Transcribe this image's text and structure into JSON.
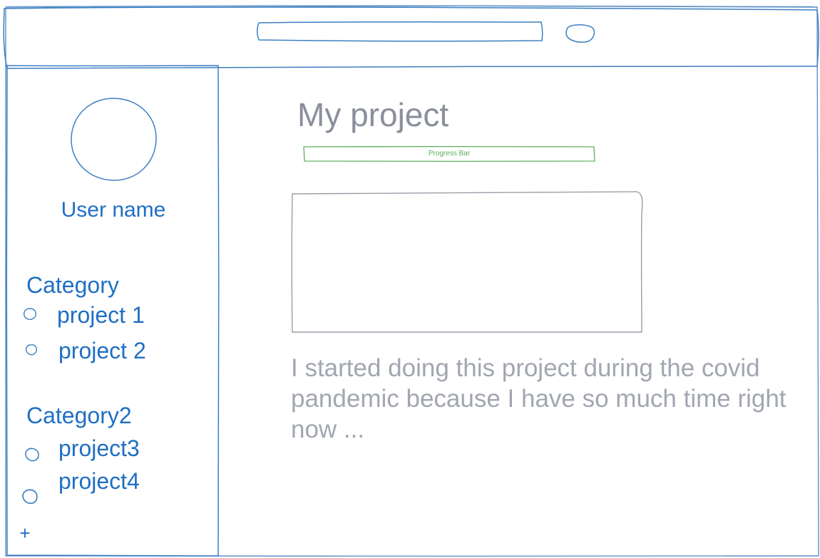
{
  "header": {
    "search": {
      "value": "",
      "placeholder": ""
    }
  },
  "sidebar": {
    "user_name": "User name",
    "categories": [
      {
        "title": "Category",
        "projects": [
          "project 1",
          "project 2"
        ]
      },
      {
        "title": "Category2",
        "projects": [
          "project3",
          "project4"
        ]
      }
    ],
    "add_label": "+"
  },
  "main": {
    "title": "My project",
    "progress": {
      "label": "Progress Bar"
    },
    "description": "I started doing this project during the covid pandemic because I have so much time right now ..."
  },
  "colors": {
    "sketch_line": "#3d7fc1",
    "sidebar_text": "#1f6fc4",
    "title_text": "#8b8f9c",
    "body_text": "#a2a6b0",
    "progress": "#5ab05a",
    "placeholder_line": "#9a9ea8"
  }
}
